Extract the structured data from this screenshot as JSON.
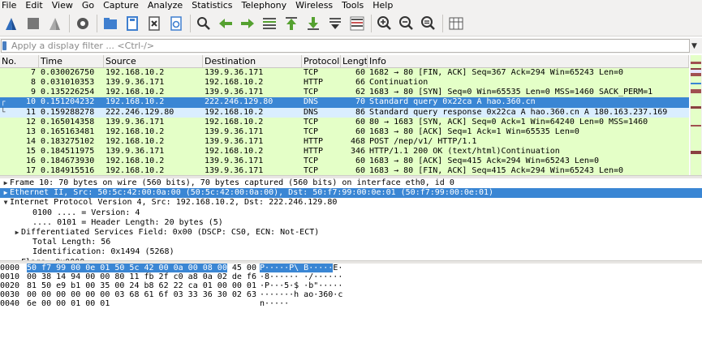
{
  "menu": [
    "File",
    "Edit",
    "View",
    "Go",
    "Capture",
    "Analyze",
    "Statistics",
    "Telephony",
    "Wireless",
    "Tools",
    "Help"
  ],
  "toolbar": {
    "icons": [
      "shark-fin-start-icon",
      "stop-square-icon",
      "restart-fin-icon",
      "options-gear-icon",
      "open-folder-icon",
      "save-file-icon",
      "close-file-icon",
      "reload-icon",
      "find-magnifier-icon",
      "back-arrow-icon",
      "forward-arrow-icon",
      "goto-packet-icon",
      "first-packet-icon",
      "last-packet-icon",
      "autoscroll-icon",
      "colorize-icon",
      "zoom-in-icon",
      "zoom-out-icon",
      "zoom-normal-icon",
      "resize-columns-icon"
    ]
  },
  "filter": {
    "placeholder": "Apply a display filter ... <Ctrl-/>",
    "value": ""
  },
  "packet_list": {
    "columns": [
      "No.",
      "Time",
      "Source",
      "Destination",
      "Protocol",
      "Length",
      "Info"
    ],
    "rows": [
      {
        "no": "7",
        "time": "0.030026750",
        "src": "192.168.10.2",
        "dst": "139.9.36.171",
        "proto": "TCP",
        "len": "60",
        "info": "1682 → 80 [FIN, ACK] Seq=367 Ack=294 Win=65243 Len=0",
        "style": "tcpg"
      },
      {
        "no": "8",
        "time": "0.031010353",
        "src": "139.9.36.171",
        "dst": "192.168.10.2",
        "proto": "HTTP",
        "len": "66",
        "info": "Continuation",
        "style": "http"
      },
      {
        "no": "9",
        "time": "0.135226254",
        "src": "192.168.10.2",
        "dst": "139.9.36.171",
        "proto": "TCP",
        "len": "62",
        "info": "1683 → 80 [SYN] Seq=0 Win=65535 Len=0 MSS=1460 SACK_PERM=1",
        "style": "tcpg"
      },
      {
        "no": "10",
        "time": "0.151204232",
        "src": "192.168.10.2",
        "dst": "222.246.129.80",
        "proto": "DNS",
        "len": "70",
        "info": "Standard query 0x22ca A hao.360.cn",
        "style": "sel"
      },
      {
        "no": "11",
        "time": "0.159288278",
        "src": "222.246.129.80",
        "dst": "192.168.10.2",
        "proto": "DNS",
        "len": "86",
        "info": "Standard query response 0x22ca A hao.360.cn A 180.163.237.169",
        "style": "dns"
      },
      {
        "no": "12",
        "time": "0.165014358",
        "src": "139.9.36.171",
        "dst": "192.168.10.2",
        "proto": "TCP",
        "len": "60",
        "info": "80 → 1683 [SYN, ACK] Seq=0 Ack=1 Win=64240 Len=0 MSS=1460",
        "style": "tcpg"
      },
      {
        "no": "13",
        "time": "0.165163481",
        "src": "192.168.10.2",
        "dst": "139.9.36.171",
        "proto": "TCP",
        "len": "60",
        "info": "1683 → 80 [ACK] Seq=1 Ack=1 Win=65535 Len=0",
        "style": "tcpg"
      },
      {
        "no": "14",
        "time": "0.183275102",
        "src": "192.168.10.2",
        "dst": "139.9.36.171",
        "proto": "HTTP",
        "len": "468",
        "info": "POST /nep/v1/ HTTP/1.1",
        "style": "http"
      },
      {
        "no": "15",
        "time": "0.184511975",
        "src": "139.9.36.171",
        "dst": "192.168.10.2",
        "proto": "HTTP",
        "len": "346",
        "info": "HTTP/1.1 200 OK  (text/html)Continuation",
        "style": "http"
      },
      {
        "no": "16",
        "time": "0.184673930",
        "src": "192.168.10.2",
        "dst": "139.9.36.171",
        "proto": "TCP",
        "len": "60",
        "info": "1683 → 80 [ACK] Seq=415 Ack=294 Win=65243 Len=0",
        "style": "tcpg"
      },
      {
        "no": "17",
        "time": "0.184915516",
        "src": "192.168.10.2",
        "dst": "139.9.36.171",
        "proto": "TCP",
        "len": "60",
        "info": "1683 → 80 [FIN, ACK] Seq=415 Ack=294 Win=65243 Len=0",
        "style": "tcpg"
      }
    ]
  },
  "details": [
    {
      "text": "Frame 10: 70 bytes on wire (560 bits), 70 bytes captured (560 bits) on interface eth0, id 0",
      "twisty": "▶",
      "indent": 0,
      "selected": false
    },
    {
      "text": "Ethernet II, Src: 50:5c:42:00:0a:00 (50:5c:42:00:0a:00), Dst: 50:f7:99:00:0e:01 (50:f7:99:00:0e:01)",
      "twisty": "▶",
      "indent": 0,
      "selected": true
    },
    {
      "text": "Internet Protocol Version 4, Src: 192.168.10.2, Dst: 222.246.129.80",
      "twisty": "▼",
      "indent": 0,
      "selected": false
    },
    {
      "text": "0100 .... = Version: 4",
      "twisty": "",
      "indent": 1,
      "selected": false
    },
    {
      "text": ".... 0101 = Header Length: 20 bytes (5)",
      "twisty": "",
      "indent": 1,
      "selected": false
    },
    {
      "text": "Differentiated Services Field: 0x00 (DSCP: CS0, ECN: Not-ECT)",
      "twisty": "▶",
      "indent": 0.5,
      "selected": false
    },
    {
      "text": "Total Length: 56",
      "twisty": "",
      "indent": 1,
      "selected": false
    },
    {
      "text": "Identification: 0x1494 (5268)",
      "twisty": "",
      "indent": 1,
      "selected": false
    },
    {
      "text": "Flags: 0x0000",
      "twisty": "▶",
      "indent": 0.5,
      "selected": false
    }
  ],
  "bytes": [
    {
      "offset": "0000",
      "hex_hl": "50 f7 99 00 0e 01 50 5c  42 00 0a 00 08 00",
      "hex_rest": " 45 00",
      "asc_hl": "P·····P\\ B·····",
      "asc_rest": "E·"
    },
    {
      "offset": "0010",
      "hex_hl": "",
      "hex_rest": "00 38 14 94 00 00 80 11  fb 2f c0 a8 0a 02 de f6",
      "asc_hl": "",
      "asc_rest": "·8······ ·/······"
    },
    {
      "offset": "0020",
      "hex_hl": "",
      "hex_rest": "81 50 e9 b1 00 35 00 24  b8 62 22 ca 01 00 00 01",
      "asc_hl": "",
      "asc_rest": "·P···5·$ ·b\"·····"
    },
    {
      "offset": "0030",
      "hex_hl": "",
      "hex_rest": "00 00 00 00 00 00 03 68  61 6f 03 33 36 30 02 63",
      "asc_hl": "",
      "asc_rest": "·······h ao·360·c"
    },
    {
      "offset": "0040",
      "hex_hl": "",
      "hex_rest": "6e 00 00 01 00 01",
      "asc_hl": "",
      "asc_rest": "n·····"
    }
  ],
  "colors": {
    "selected": "#3a86d4",
    "http_row": "#e4ffc7",
    "dns_row": "#daeeff"
  }
}
